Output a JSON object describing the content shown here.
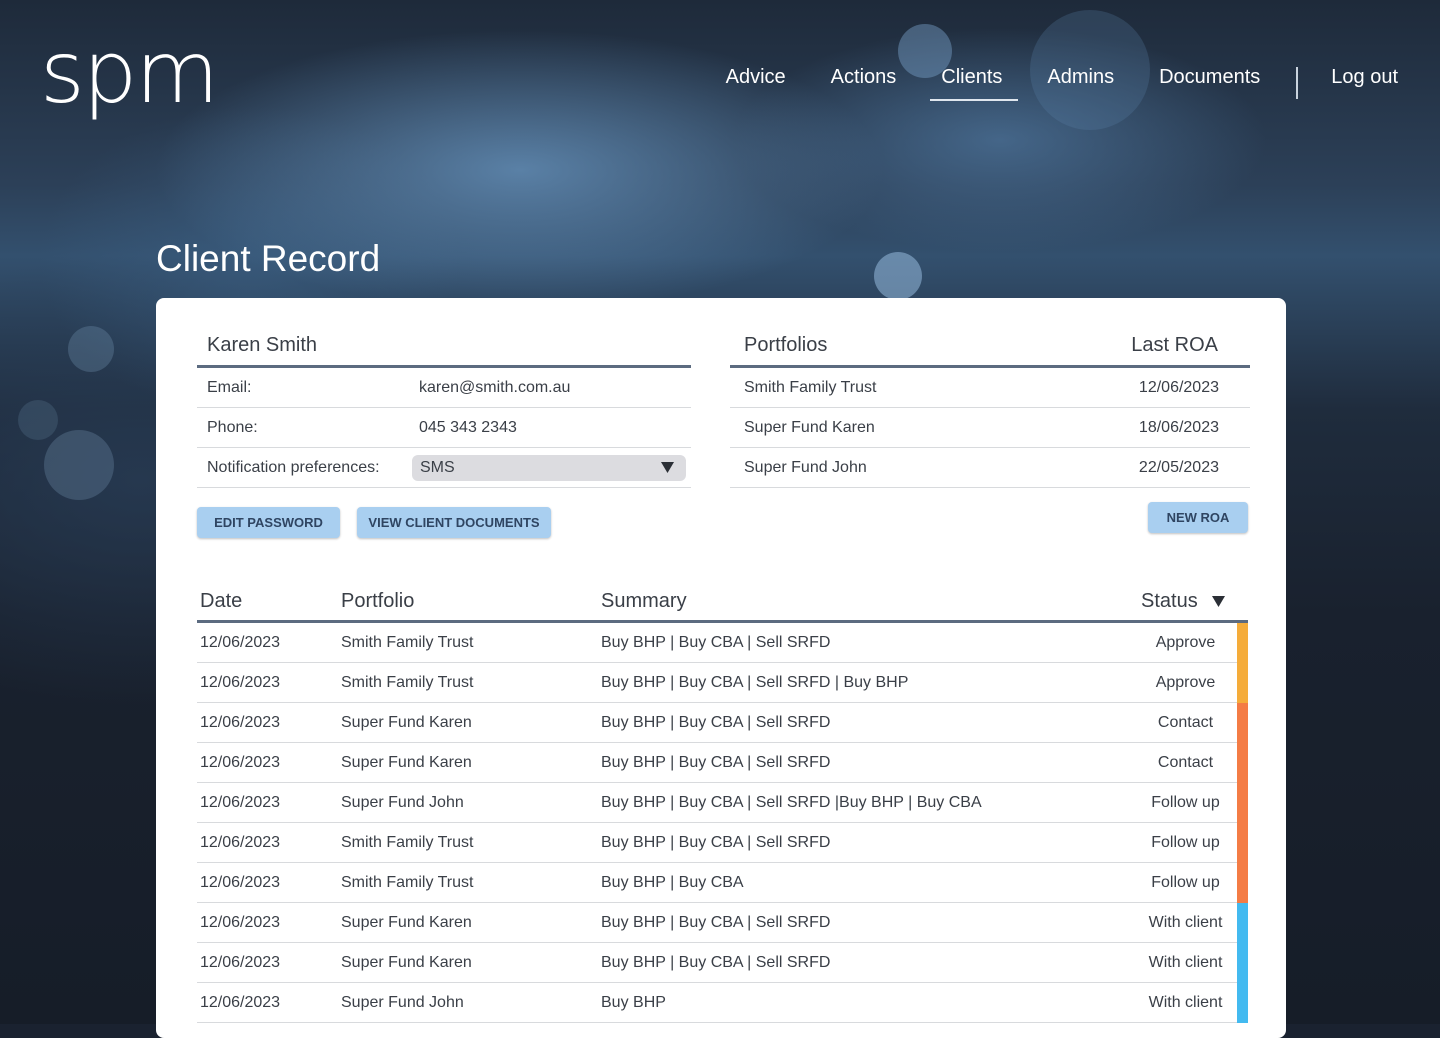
{
  "brand": {
    "logo": "spm"
  },
  "nav": {
    "items": [
      {
        "label": "Advice"
      },
      {
        "label": "Actions"
      },
      {
        "label": "Clients",
        "active": true
      },
      {
        "label": "Admins"
      },
      {
        "label": "Documents"
      }
    ],
    "logout": "Log out"
  },
  "page": {
    "title": "Client Record"
  },
  "client": {
    "name": "Karen Smith",
    "email_label": "Email:",
    "email": "karen@smith.com.au",
    "phone_label": "Phone:",
    "phone": "045 343 2343",
    "notif_label": "Notification preferences:",
    "notif_value": "SMS",
    "buttons": {
      "edit_password": "EDIT PASSWORD",
      "view_documents": "VIEW CLIENT DOCUMENTS"
    }
  },
  "portfolios": {
    "header_name": "Portfolios",
    "header_date": "Last ROA",
    "rows": [
      {
        "name": "Smith Family Trust",
        "date": "12/06/2023"
      },
      {
        "name": "Super Fund Karen",
        "date": "18/06/2023"
      },
      {
        "name": "Super Fund John",
        "date": "22/05/2023"
      }
    ],
    "new_roa": "NEW ROA"
  },
  "actions_table": {
    "headers": {
      "date": "Date",
      "portfolio": "Portfolio",
      "summary": "Summary",
      "status": "Status"
    },
    "status_colors": {
      "Approve": "#f5ac3a",
      "Contact": "#f47c45",
      "Follow up": "#f47c45",
      "With client": "#43baf0"
    },
    "rows": [
      {
        "date": "12/06/2023",
        "portfolio": "Smith Family Trust",
        "summary": "Buy BHP | Buy CBA | Sell SRFD",
        "status": "Approve"
      },
      {
        "date": "12/06/2023",
        "portfolio": "Smith Family Trust",
        "summary": "Buy BHP | Buy CBA | Sell SRFD | Buy BHP",
        "status": "Approve"
      },
      {
        "date": "12/06/2023",
        "portfolio": "Super Fund Karen",
        "summary": "Buy BHP | Buy CBA | Sell SRFD",
        "status": "Contact"
      },
      {
        "date": "12/06/2023",
        "portfolio": "Super Fund Karen",
        "summary": "Buy BHP | Buy CBA | Sell SRFD",
        "status": "Contact"
      },
      {
        "date": "12/06/2023",
        "portfolio": "Super Fund John",
        "summary": "Buy BHP | Buy CBA | Sell SRFD |Buy BHP | Buy CBA",
        "status": "Follow up"
      },
      {
        "date": "12/06/2023",
        "portfolio": "Smith Family Trust",
        "summary": "Buy BHP | Buy CBA | Sell SRFD",
        "status": "Follow up"
      },
      {
        "date": "12/06/2023",
        "portfolio": "Smith Family Trust",
        "summary": "Buy BHP | Buy CBA",
        "status": "Follow up"
      },
      {
        "date": "12/06/2023",
        "portfolio": "Super Fund Karen",
        "summary": "Buy BHP | Buy CBA | Sell SRFD",
        "status": "With client"
      },
      {
        "date": "12/06/2023",
        "portfolio": "Super Fund Karen",
        "summary": "Buy BHP | Buy CBA | Sell SRFD",
        "status": "With client"
      },
      {
        "date": "12/06/2023",
        "portfolio": "Super Fund John",
        "summary": "Buy BHP",
        "status": "With client"
      }
    ]
  }
}
